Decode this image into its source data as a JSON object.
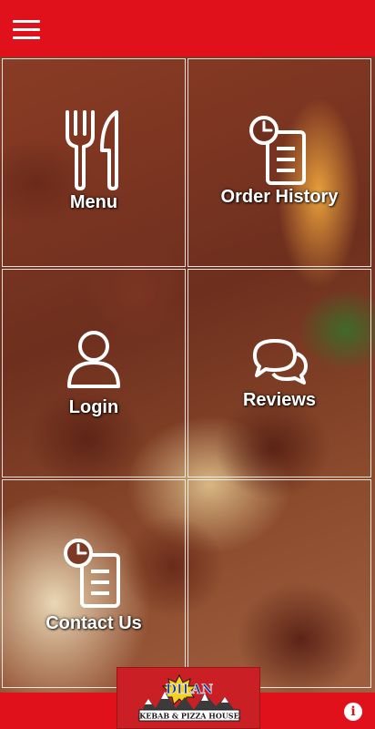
{
  "header": {
    "menu_icon": "hamburger-icon"
  },
  "tiles": [
    {
      "label": "Menu",
      "icon": "fork-knife-icon"
    },
    {
      "label": "Order History",
      "icon": "clock-document-icon"
    },
    {
      "label": "Login",
      "icon": "user-icon"
    },
    {
      "label": "Reviews",
      "icon": "chat-bubbles-icon"
    },
    {
      "label": "Contact Us",
      "icon": "clock-document-icon"
    },
    {
      "label": "",
      "icon": ""
    }
  ],
  "footer": {
    "logo": {
      "name": "DILAN",
      "tagline": "KEBAB & PIZZA HOUSE"
    },
    "info_icon": "info-icon",
    "info_glyph": "i"
  },
  "colors": {
    "brand_red": "#e1111b",
    "text": "#ffffff"
  }
}
